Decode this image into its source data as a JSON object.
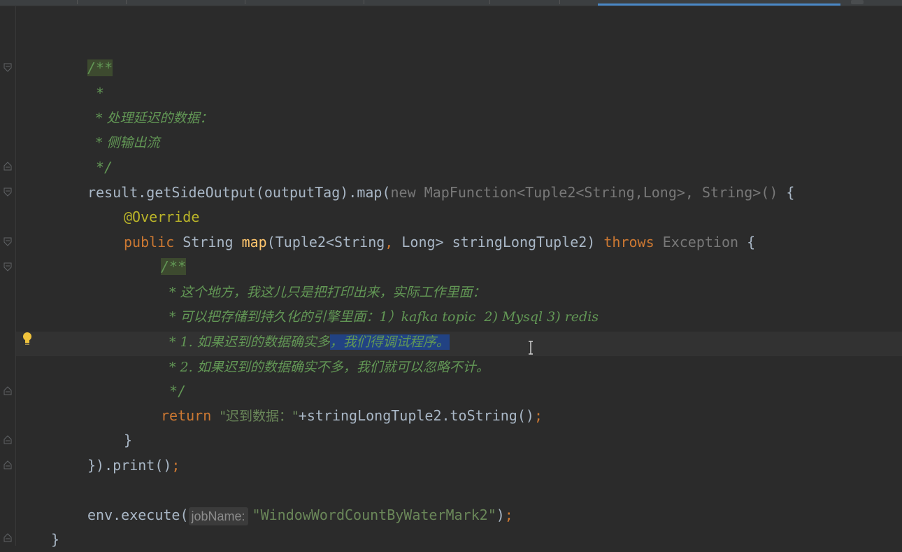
{
  "editor": {
    "lines": {
      "l1": "/**",
      "l2": "*",
      "l3": "* 处理延迟的数据：",
      "l4": "* 侧输出流",
      "l5": "*/",
      "l6_a": "result.getSideOutput(outputTag).map(",
      "l6_b": "new",
      "l6_c": " MapFunction<Tuple2<String,Long>, String>()",
      "l6_d": " {",
      "l7": "@Override",
      "l8_a": "public",
      "l8_b": " String ",
      "l8_c": "map",
      "l8_d": "(Tuple2<String",
      "l8_e": ",",
      "l8_f": " Long> stringLongTuple2) ",
      "l8_g": "throws",
      "l8_h": " Exception",
      "l8_i": " {",
      "l9": "/**",
      "l10": "* 这个地方，我这儿只是把打印出来，实际工作里面：",
      "l11": "* 可以把存储到持久化的引擎里面：1）kafka topic  2) Mysql 3) redis",
      "l12_a": "* 1. 如果迟到的数据确实多",
      "l12_b": "，我们得调试程序。",
      "l13": "* 2. 如果迟到的数据确实不多，我们就可以忽略不计。",
      "l14": "*/",
      "l15_a": "return",
      "l15_b": "\"迟到数据：\"",
      "l15_c": "+stringLongTuple2.toString()",
      "l15_d": ";",
      "l16": "}",
      "l17_a": "}).print()",
      "l17_b": ";",
      "l18_a": "env.execute(",
      "l18_hint": "jobName:",
      "l18_b": "\"WindowWordCountByWaterMark2\"",
      "l18_c": ")",
      "l18_d": ";",
      "l19": "}"
    }
  }
}
